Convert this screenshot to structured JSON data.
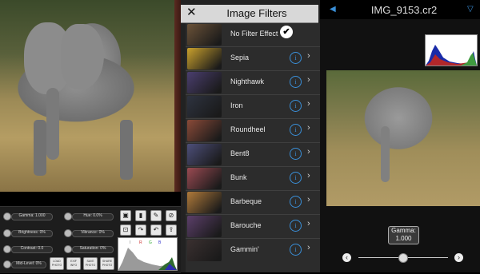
{
  "left_panel": {
    "sliders": [
      {
        "label": "Gamma: 1.000"
      },
      {
        "label": "Hue: 0.0%"
      },
      {
        "label": "Brightness: 0%"
      },
      {
        "label": "Vibrance: 0%"
      },
      {
        "label": "Contrast: 0.0"
      },
      {
        "label": "Saturation: 0%"
      },
      {
        "label": "Mid-Level: 0%"
      }
    ],
    "tool_icons": [
      "save-icon",
      "histogram-icon",
      "brush-icon",
      "crop-icon",
      "redo-icon",
      "undo-icon",
      "share-icon"
    ],
    "bottom_buttons": [
      "LOAD PHOTO",
      "EXIF INFO",
      "SAVE PHOTO",
      "SHARE PHOTO"
    ],
    "histogram_legend": [
      "I",
      "R",
      "G",
      "B"
    ]
  },
  "filters_panel": {
    "title": "Image Filters",
    "close_glyph": "✕",
    "items": [
      {
        "name": "No Filter Effect",
        "selected": true,
        "thumb_color": "#6b5238"
      },
      {
        "name": "Sepia",
        "thumb_color": "#caa12d"
      },
      {
        "name": "Nighthawk",
        "thumb_color": "#4a3e6e"
      },
      {
        "name": "Iron",
        "thumb_color": "#2e3340"
      },
      {
        "name": "Roundheel",
        "thumb_color": "#8a4a38"
      },
      {
        "name": "Bent8",
        "thumb_color": "#4d4f7a"
      },
      {
        "name": "Bunk",
        "thumb_color": "#9a4a52"
      },
      {
        "name": "Barbeque",
        "thumb_color": "#b07a3a"
      },
      {
        "name": "Barouche",
        "thumb_color": "#5c3f6a"
      },
      {
        "name": "Gammin'",
        "thumb_color": "#3a3030"
      }
    ],
    "info_glyph": "i",
    "chevron_glyph": "›",
    "check_glyph": "✔"
  },
  "right_panel": {
    "title": "IMG_9153.cr2",
    "gamma_bubble": {
      "line1": "Gamma:",
      "line2": "1.000"
    },
    "gamma_value": 1.0,
    "left_button": "‹",
    "right_button": "›"
  },
  "colors": {
    "accent_blue": "#3a8fd8"
  }
}
